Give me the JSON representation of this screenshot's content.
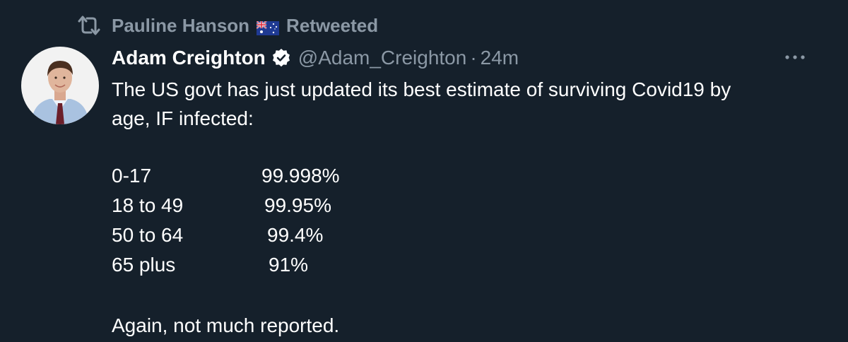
{
  "retweet_banner": {
    "user": "Pauline Hanson",
    "label": "Retweeted"
  },
  "tweet": {
    "display_name": "Adam Creighton",
    "handle": "@Adam_Creighton",
    "separator": "·",
    "time": "24m",
    "text_line_1": "The US govt has just updated its best estimate of surviving Covid19 by",
    "text_line_2": "age, IF infected:",
    "survival_rows": [
      {
        "age": "0-17",
        "value": "99.998%"
      },
      {
        "age": "18 to 49",
        "value": "99.95%"
      },
      {
        "age": "50 to 64",
        "value": "99.4%"
      },
      {
        "age": "65 plus",
        "value": "91%"
      }
    ],
    "footer": "Again, not much reported."
  },
  "colors": {
    "background": "#15202b",
    "text_primary": "#ffffff",
    "text_secondary": "#8b98a5",
    "verified_badge": "#ffffff"
  },
  "icons": {
    "retweet": "retweet-icon",
    "flag": "australian-flag-icon",
    "verified": "verified-badge-icon",
    "more": "more-options-icon"
  }
}
